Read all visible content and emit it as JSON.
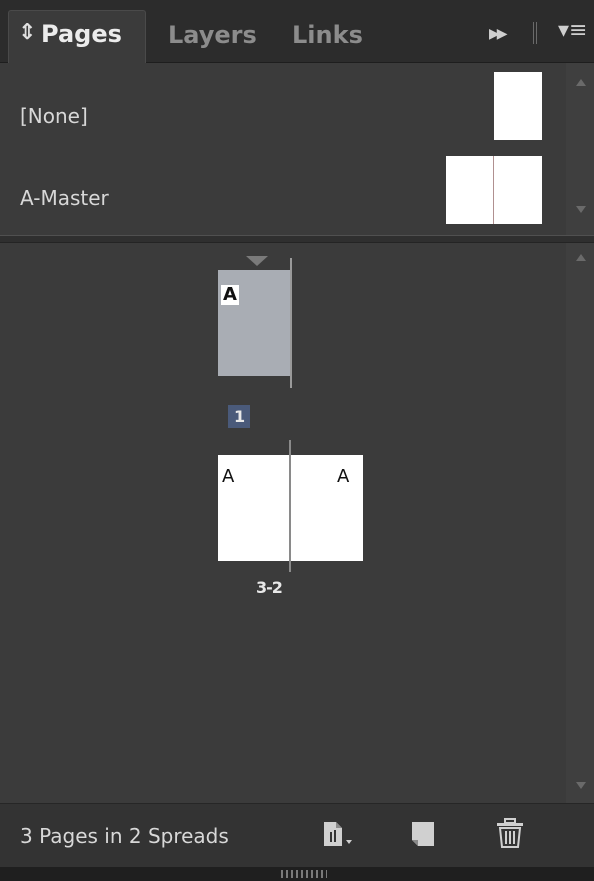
{
  "tabs": [
    {
      "label": "Pages",
      "active": true
    },
    {
      "label": "Layers",
      "active": false
    },
    {
      "label": "Links",
      "active": false
    }
  ],
  "icons": {
    "sort": "⇕",
    "collapse": "▶▶",
    "menu": "▾≡",
    "create_page_size": "create-page-size-icon",
    "new_page": "new-page-icon",
    "delete_page": "trash-icon"
  },
  "masters": [
    {
      "label": "[None]",
      "thumbnail": "single-page"
    },
    {
      "label": "A-Master",
      "thumbnail": "spread"
    }
  ],
  "spreads": [
    {
      "number_label": "1",
      "pages": [
        {
          "master": "A",
          "selected": true
        }
      ]
    },
    {
      "number_label": "3-2",
      "pages": [
        {
          "master": "A",
          "selected": false
        },
        {
          "master": "A",
          "selected": false
        }
      ]
    }
  ],
  "status": {
    "text": "3 Pages in 2 Spreads"
  },
  "colors": {
    "panel": "#3b3b3b",
    "tabbar": "#2c2c2c",
    "selected_page": "#a9adb4",
    "selected_label_bg": "#4a5a7a"
  }
}
